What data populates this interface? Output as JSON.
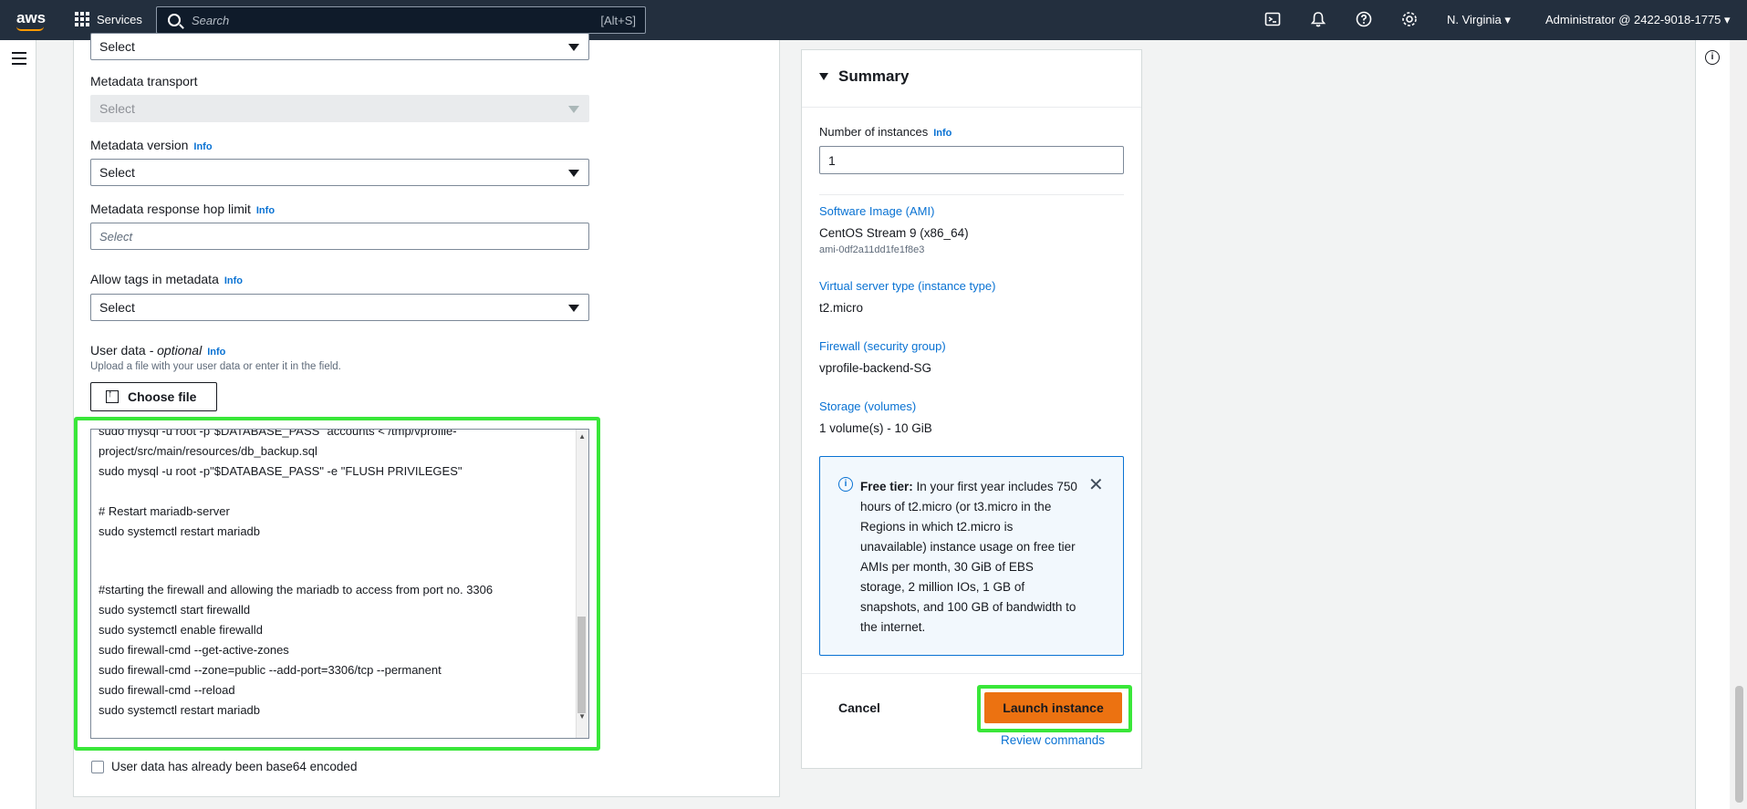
{
  "topbar": {
    "logo": "aws",
    "services_label": "Services",
    "search_placeholder": "Search",
    "search_shortcut": "[Alt+S]",
    "region": "N. Virginia ▾",
    "account": "Administrator @ 2422-9018-1775 ▾",
    "icons": [
      "cloudshell-icon",
      "bell-icon",
      "help-icon",
      "settings-icon"
    ]
  },
  "form": {
    "first_select_value": "Select",
    "metadata_transport": {
      "label": "Metadata transport",
      "value": "Select"
    },
    "metadata_version": {
      "label": "Metadata version",
      "info": "Info",
      "value": "Select"
    },
    "hop_limit": {
      "label": "Metadata response hop limit",
      "info": "Info",
      "placeholder": "Select"
    },
    "allow_tags": {
      "label": "Allow tags in metadata",
      "info": "Info",
      "value": "Select"
    },
    "user_data": {
      "label": "User data",
      "optional": " - optional",
      "info": "Info",
      "description": "Upload a file with your user data or enter it in the field.",
      "choose_file": "Choose file",
      "lines": [
        "sudo mysql -u root -p\"$DATABASE_PASS\" accounts < /tmp/vprofile-",
        "project/src/main/resources/db_backup.sql",
        "sudo mysql -u root -p\"$DATABASE_PASS\" -e \"FLUSH PRIVILEGES\"",
        "",
        "# Restart mariadb-server",
        "sudo systemctl restart mariadb",
        "",
        "",
        "#starting the firewall and allowing the mariadb to access from port no. 3306",
        "sudo systemctl start firewalld",
        "sudo systemctl enable firewalld",
        "sudo firewall-cmd --get-active-zones",
        "sudo firewall-cmd --zone=public --add-port=3306/tcp --permanent",
        "sudo firewall-cmd --reload",
        "sudo systemctl restart mariadb"
      ],
      "base64_label": "User data has already been base64 encoded"
    }
  },
  "summary": {
    "title": "Summary",
    "num_instances_label": "Number of instances",
    "num_instances_info": "Info",
    "num_instances_value": "1",
    "ami_label": "Software Image (AMI)",
    "ami_value": "CentOS Stream 9 (x86_64)",
    "ami_id": "ami-0df2a11dd1fe1f8e3",
    "instance_type_label": "Virtual server type (instance type)",
    "instance_type_value": "t2.micro",
    "firewall_label": "Firewall (security group)",
    "firewall_value": "vprofile-backend-SG",
    "storage_label": "Storage (volumes)",
    "storage_value": "1 volume(s) - 10 GiB",
    "free_tier_bold": "Free tier:",
    "free_tier_text": " In your first year includes 750 hours of t2.micro (or t3.micro in the Regions in which t2.micro is unavailable) instance usage on free tier AMIs per month, 30 GiB of EBS storage, 2 million IOs, 1 GB of snapshots, and 100 GB of bandwidth to the internet.",
    "cancel": "Cancel",
    "launch": "Launch instance",
    "review": "Review commands"
  },
  "colors": {
    "highlight": "#39e739",
    "launch": "#ec7211",
    "link": "#0972d3"
  }
}
